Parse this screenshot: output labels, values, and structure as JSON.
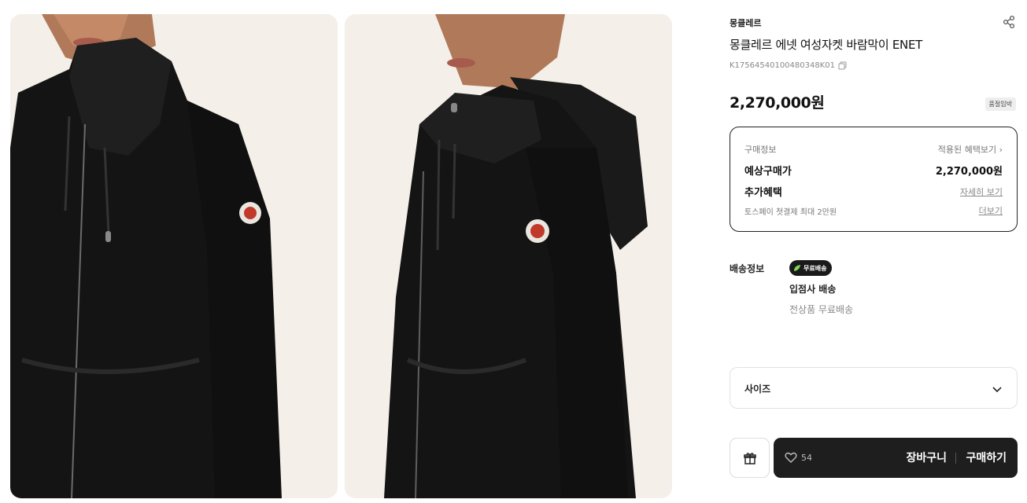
{
  "product": {
    "brand": "몽클레르",
    "title": "몽클레르 에넷 여성자켓 바람막이 ENET",
    "code": "K17564540100480348K01",
    "price": "2,270,000원",
    "auth_badge": "품절임박"
  },
  "gallery": {
    "images": [
      {
        "alt": "front"
      },
      {
        "alt": "side"
      }
    ]
  },
  "purchase_info": {
    "heading": "구매정보",
    "benefit_link": "적용된 혜택보기 ›",
    "expected_label": "예상구매가",
    "expected_price": "2,270,000원",
    "extra_label": "추가혜택",
    "extra_link": "자세히 보기",
    "toss_text": "토스페이 첫결제 최대 2만원",
    "toss_link": "더보기"
  },
  "shipping": {
    "label": "배송정보",
    "badge": "무료배송",
    "method": "입점사 배송",
    "desc": "전상품 무료배송"
  },
  "size": {
    "label": "사이즈"
  },
  "actions": {
    "like_count": "54",
    "cart": "장바구니",
    "buy": "구매하기"
  },
  "colors": {
    "jacket": "#141414",
    "background": "#f4efe9",
    "button_dark": "#1e1e1e"
  }
}
